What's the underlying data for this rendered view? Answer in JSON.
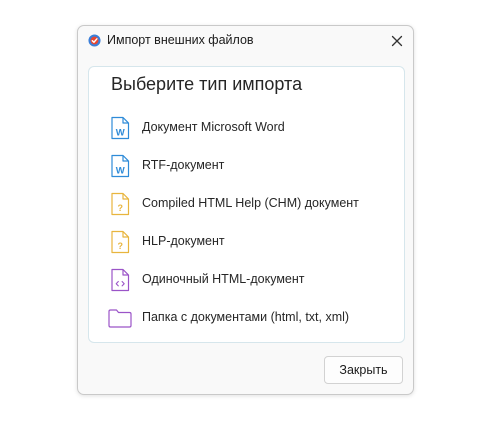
{
  "window": {
    "title": "Импорт внешних файлов",
    "app_icon": "app-logo-icon",
    "close_icon": "close-icon"
  },
  "panel": {
    "heading": "Выберите тип импорта",
    "items": [
      {
        "label": "Документ Microsoft Word",
        "icon": "word-document-icon",
        "color": "#2e8bd8"
      },
      {
        "label": "RTF-документ",
        "icon": "rtf-document-icon",
        "color": "#2e8bd8"
      },
      {
        "label": "Compiled HTML Help (CHM) документ",
        "icon": "chm-document-icon",
        "color": "#e8b53e"
      },
      {
        "label": "HLP-документ",
        "icon": "hlp-document-icon",
        "color": "#e8b53e"
      },
      {
        "label": "Одиночный HTML-документ",
        "icon": "html-document-icon",
        "color": "#9b54c8"
      },
      {
        "label": "Папка с документами (html, txt, xml)",
        "icon": "folder-icon",
        "color": "#9b54c8"
      }
    ]
  },
  "footer": {
    "close_label": "Закрыть"
  }
}
